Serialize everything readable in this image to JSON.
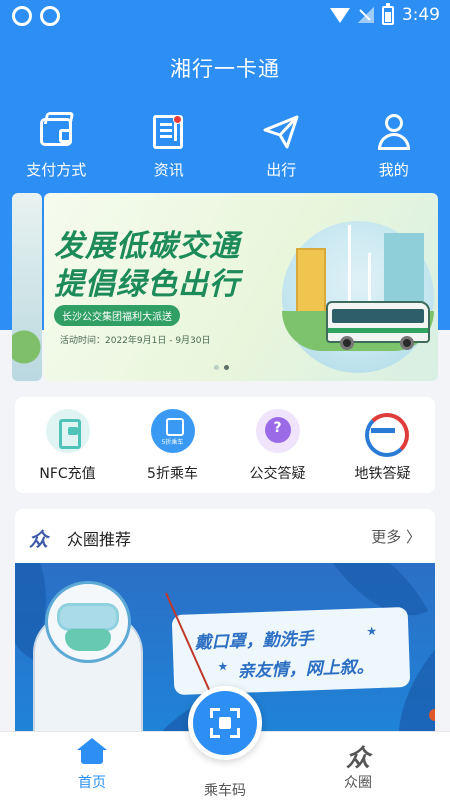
{
  "status_bar": {
    "time": "3:49"
  },
  "app_title": "湘行一卡通",
  "top_menu": [
    {
      "label": "支付方式",
      "icon": "wallet-icon"
    },
    {
      "label": "资讯",
      "icon": "news-icon",
      "badge": "red-dot"
    },
    {
      "label": "出行",
      "icon": "paper-plane-icon"
    },
    {
      "label": "我的",
      "icon": "user-icon"
    }
  ],
  "banner": {
    "title_line1": "发展低碳交通",
    "title_line2": "提倡绿色出行",
    "tag": "长沙公交集团福利大派送",
    "date": "活动时间：2022年9月1日 - 9月30日"
  },
  "services": [
    {
      "label": "NFC充值",
      "icon": "nfc-card-icon"
    },
    {
      "label": "5折乘车",
      "icon": "bus-discount-icon",
      "icon_text": "5折乘车"
    },
    {
      "label": "公交答疑",
      "icon": "question-icon",
      "icon_text": "?"
    },
    {
      "label": "地铁答疑",
      "icon": "metro-logo-icon"
    }
  ],
  "recommend": {
    "logo": "众",
    "title": "众圈推荐",
    "more": "更多 〉",
    "image_text_line1": "戴口罩，勤洗手",
    "image_text_line2": "亲友情，网上叙。"
  },
  "bottom_nav": [
    {
      "label": "首页",
      "icon": "home-icon",
      "active": true
    },
    {
      "label": "乘车码",
      "icon": "scan-code-icon",
      "active": false
    },
    {
      "label": "众圈",
      "icon": "circle-logo-icon",
      "active": false
    }
  ],
  "colors": {
    "primary": "#2d8ff3",
    "banner_green": "#1d8a5a",
    "badge_red": "#e83a3a"
  }
}
